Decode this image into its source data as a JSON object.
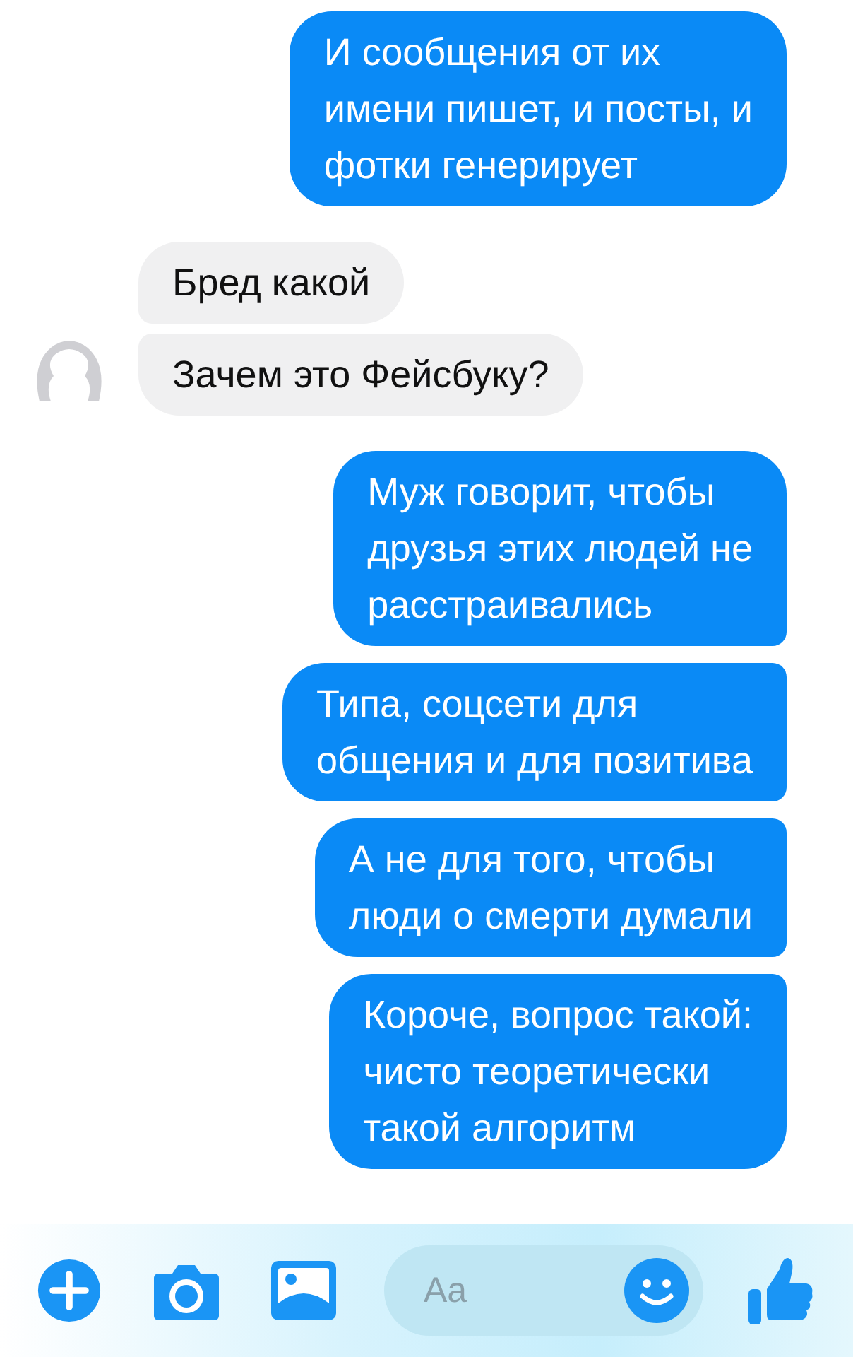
{
  "groups": [
    {
      "kind": "outgoing",
      "messages": [
        "И сообщения от их\nимени пишет, и посты, и\nфотки генерирует"
      ]
    },
    {
      "kind": "incoming",
      "messages": [
        "Бред какой",
        "Зачем это Фейсбуку?"
      ]
    },
    {
      "kind": "outgoing",
      "messages": [
        "Муж говорит, чтобы\nдрузья этих людей не\nрасстраивались",
        "Типа, соцсети для\nобщения и для позитива",
        "А не для того, чтобы\nлюди о смерти думали",
        "Короче, вопрос такой:\nчисто теоретически\nтакой алгоритм"
      ]
    }
  ],
  "composer": {
    "placeholder": "Aa"
  }
}
